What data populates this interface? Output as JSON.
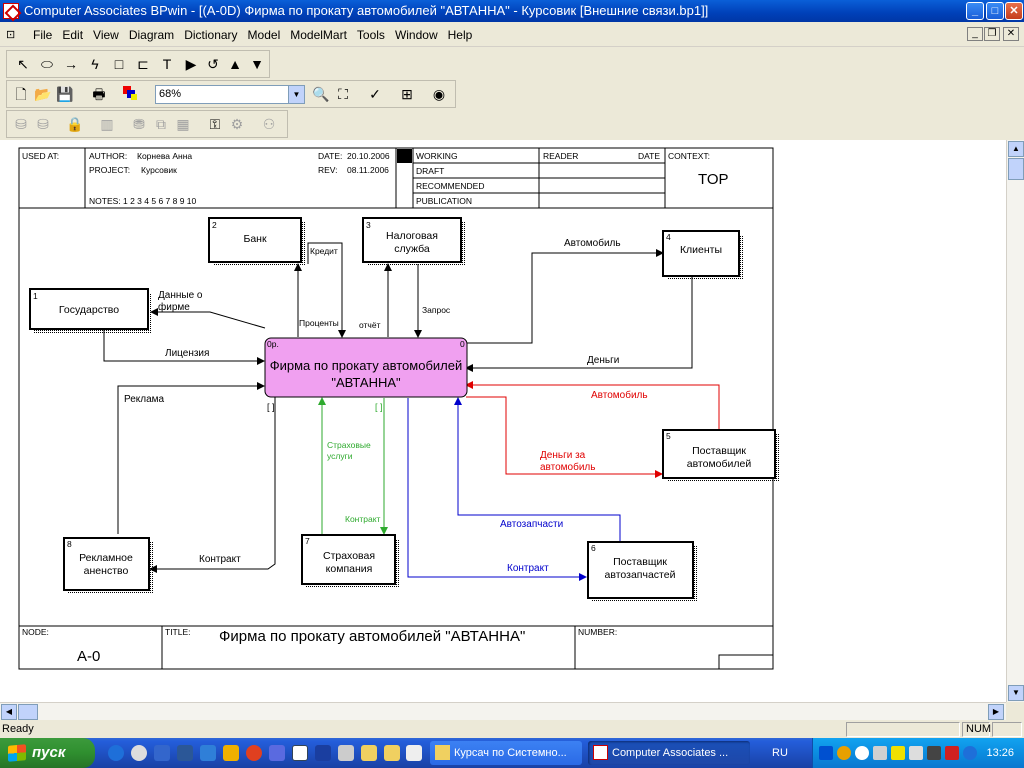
{
  "window": {
    "title": "Computer Associates BPwin - [(A-0D) Фирма по прокату автомобилей \"АВТАННА\" - Курсовик  [Внешние связи.bp1]]",
    "min": "_",
    "max": "□",
    "close": "✕"
  },
  "menu": {
    "items": [
      "File",
      "Edit",
      "View",
      "Diagram",
      "Dictionary",
      "Model",
      "ModelMart",
      "Tools",
      "Window",
      "Help"
    ]
  },
  "mdi": {
    "min": "_",
    "restore": "❐",
    "close": "✕"
  },
  "toolbar1": {
    "tools": [
      {
        "name": "pointer-tool",
        "icon": "↖"
      },
      {
        "name": "ellipse-tool",
        "icon": "⬭"
      },
      {
        "name": "arrow-tool",
        "icon": "→"
      },
      {
        "name": "squiggle-tool",
        "icon": "ϟ"
      },
      {
        "name": "box-tool",
        "icon": "□"
      },
      {
        "name": "data-store-tool",
        "icon": "⊏"
      },
      {
        "name": "text-tool",
        "icon": "T"
      },
      {
        "name": "go-to-child-tool",
        "icon": "▶"
      },
      {
        "name": "go-to-sibling-tool",
        "icon": "↺"
      },
      {
        "name": "go-to-parent-tool",
        "icon": "▲"
      },
      {
        "name": "go-down-tool",
        "icon": "▼"
      }
    ]
  },
  "toolbar2": {
    "zoom_value": "68%",
    "dropdown": "▼"
  },
  "diagram": {
    "header": {
      "used_at": "USED AT:",
      "author_label": "AUTHOR:",
      "author": "Корнева Анна",
      "project_label": "PROJECT:",
      "project": "Курсовик",
      "date_label": "DATE:",
      "date": "20.10.2006",
      "rev_label": "REV:",
      "rev": "08.11.2006",
      "notes": "NOTES:  1  2  3  4  5  6  7  8  9  10",
      "working": "WORKING",
      "draft": "DRAFT",
      "recommended": "RECOMMENDED",
      "publication": "PUBLICATION",
      "reader": "READER",
      "date2": "DATE",
      "context": "CONTEXT:",
      "top": "TOP"
    },
    "footer": {
      "node_label": "NODE:",
      "node": "A-0",
      "title_label": "TITLE:",
      "title": "Фирма по прокату автомобилей \"АВТАННА\"",
      "number_label": "NUMBER:"
    },
    "main_process": {
      "id": "0р.",
      "num": "0",
      "line1": "Фирма по прокату автомобилей",
      "line2": "\"АВТАННА\""
    },
    "entities": {
      "bank": {
        "num": "2",
        "label": "Банк"
      },
      "tax": {
        "num": "3",
        "label1": "Налоговая",
        "label2": "служба"
      },
      "clients": {
        "num": "4",
        "label": "Клиенты"
      },
      "state": {
        "num": "1",
        "label": "Государство"
      },
      "car_supplier": {
        "num": "5",
        "label1": "Поставщик",
        "label2": "автомобилей"
      },
      "parts_supplier": {
        "num": "6",
        "label1": "Поставщик",
        "label2": "автозапчастей"
      },
      "insurance": {
        "num": "7",
        "label1": "Страховая",
        "label2": "компания"
      },
      "ad_agency": {
        "num": "8",
        "label1": "Рекламное",
        "label2": "аненство"
      }
    },
    "arrows": {
      "credit": "Кредит",
      "interest": "Проценты",
      "report": "отчёт",
      "request": "Запрос",
      "car_out": "Автомобиль",
      "money_in": "Деньги",
      "company_data1": "Данные о",
      "company_data2": "фирме",
      "license": "Лицензия",
      "ad": "Реклама",
      "car_in": "Автомобиль",
      "money_for_car1": "Деньги за",
      "money_for_car2": "автомобиль",
      "ins_services1": "Страховые",
      "ins_services2": "услуги",
      "contract_ins": "Контракт",
      "parts": "Автозапчасти",
      "contract_parts": "Контракт",
      "contract_ad": "Контракт",
      "tunnel1": "[ ]",
      "tunnel2": "[ ]"
    },
    "colors": {
      "black": "#000000",
      "red": "#e00000",
      "green": "#2eaa2e",
      "blue": "#0000cc",
      "process_fill": "#f0a0f0"
    }
  },
  "scroll": {
    "up": "▲",
    "down": "▼",
    "left": "◀",
    "right": "▶"
  },
  "status": {
    "text": "Ready",
    "num": "NUM"
  },
  "taskbar": {
    "start": "пуск",
    "tasks": [
      "Курсач по Системно...",
      "Computer Associates ..."
    ],
    "lang": "RU",
    "clock": "13:26"
  }
}
